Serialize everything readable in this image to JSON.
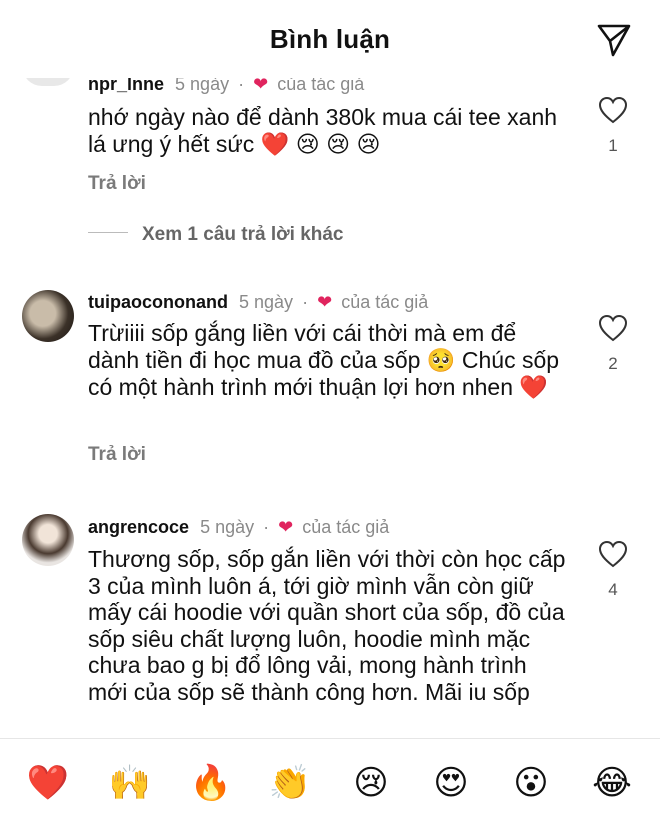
{
  "header": {
    "title": "Bình luận"
  },
  "comments": [
    {
      "username": "npr_lnne",
      "time": "5 ngày",
      "author_label": "của tác giả",
      "text": "nhớ ngày nào để dành 380k mua cái tee xanh lá ưng ý hết sức ❤️ 😢 😢 😢",
      "reply": "Trả lời",
      "likes": "1"
    },
    {
      "username": "tuipaocononand",
      "time": "5 ngày",
      "author_label": "của tác giả",
      "text": "Trừiiii sốp gắng liền với cái thời mà em để dành tiền đi học mua đồ của sốp 🥺 Chúc sốp có một hành trình mới thuận lợi hơn nhen ❤️",
      "reply": "Trả lời",
      "likes": "2"
    },
    {
      "username": "angrencoce",
      "time": "5 ngày",
      "author_label": "của tác giả",
      "text": "Thương sốp, sốp gắn liền với thời còn học cấp 3 của mình luôn á, tới giờ mình vẫn còn giữ mấy cái hoodie với quần short của sốp, đồ của sốp siêu chất lượng luôn, hoodie mình mặc chưa bao g bị đổ lông vải, mong hành trình mới của sốp sẽ thành công hơn. Mãi iu sốp",
      "likes": "4"
    }
  ],
  "more_replies": "Xem 1 câu trả lời khác",
  "emoji_bar": [
    "❤️",
    "🙌",
    "🔥",
    "👏",
    "😢",
    "😍",
    "😮",
    "😂"
  ]
}
